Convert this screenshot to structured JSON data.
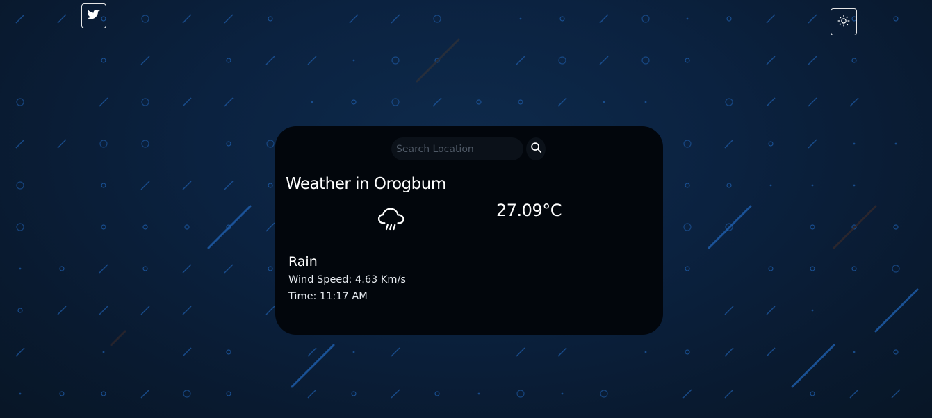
{
  "header": {
    "twitter_icon": "twitter-icon",
    "theme_icon": "sun-icon"
  },
  "search": {
    "placeholder": "Search Location",
    "value": "",
    "icon": "search-icon"
  },
  "weather": {
    "title": "Weather in Orogbum",
    "icon": "rain-cloud-icon",
    "temperature": "27.09°C",
    "condition": "Rain",
    "wind": "Wind Speed: 4.63 Km/s",
    "time": "Time: 11:17 AM"
  },
  "colors": {
    "background": "#0b2240",
    "card": "#02060c",
    "accent_blue": "#1e5fb3",
    "text": "#ffffff"
  }
}
